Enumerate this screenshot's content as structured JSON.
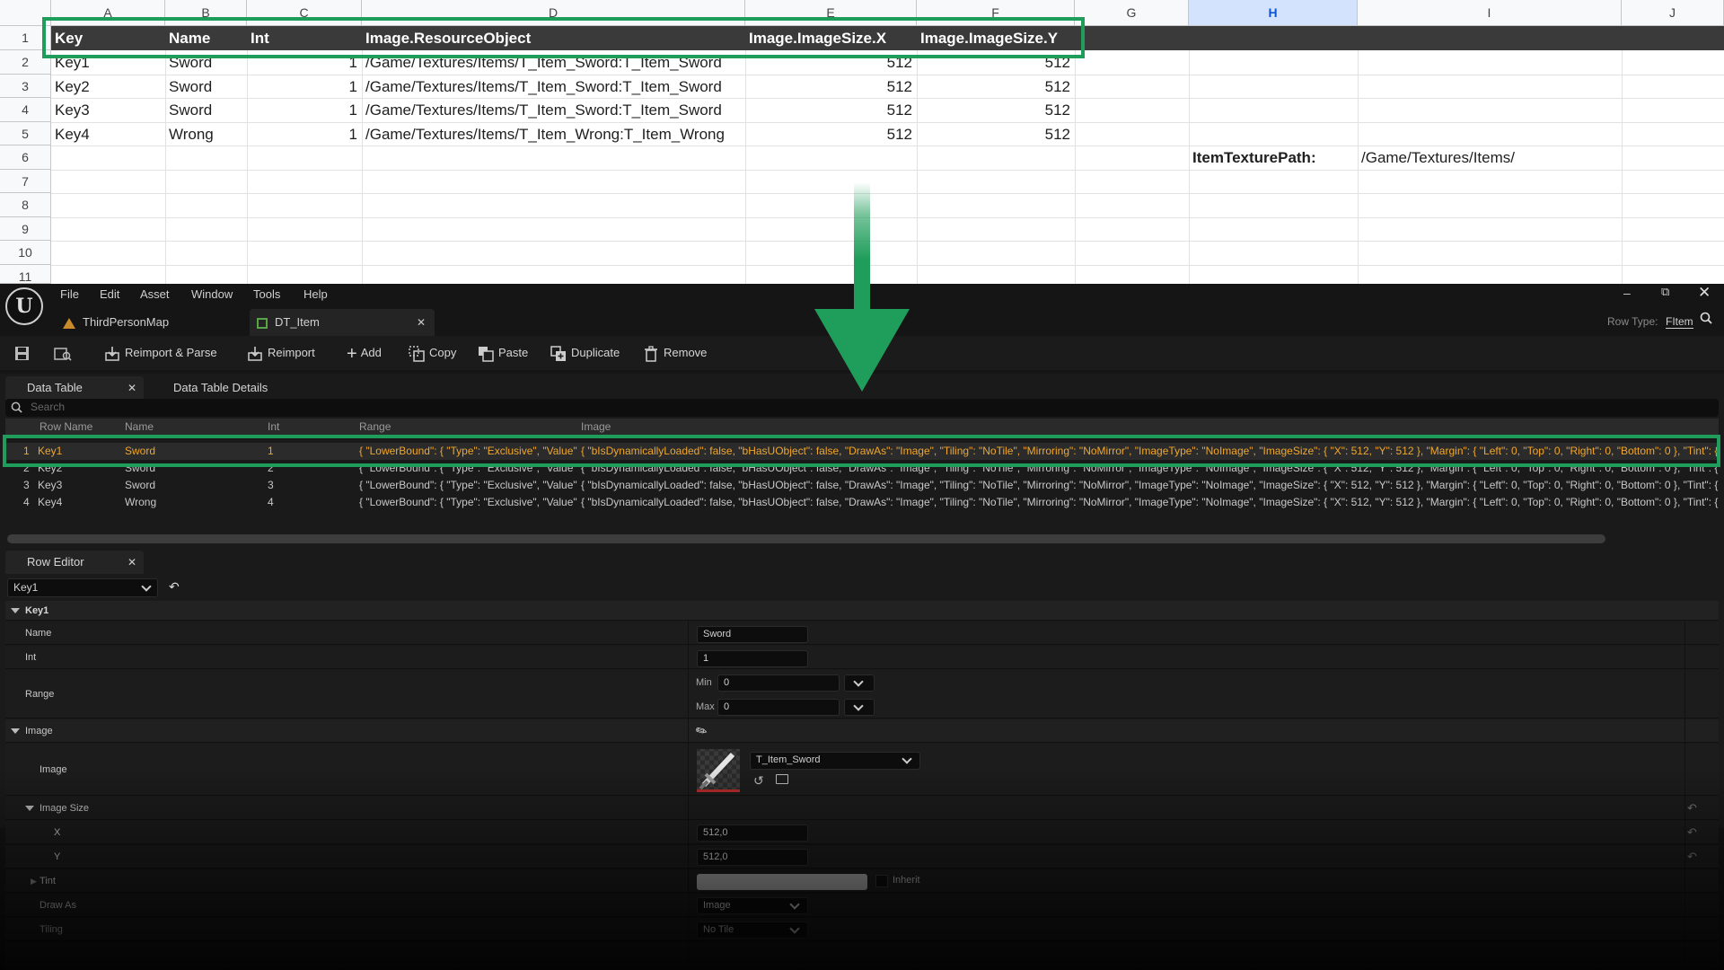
{
  "sheet": {
    "columns": [
      "A",
      "B",
      "C",
      "D",
      "E",
      "F",
      "G",
      "H",
      "I",
      "J"
    ],
    "rows": [
      "1",
      "2",
      "3",
      "4",
      "5",
      "6",
      "7",
      "8",
      "9",
      "10",
      "11"
    ],
    "header": [
      "Key",
      "Name",
      "Int",
      "Image.ResourceObject",
      "Image.ImageSize.X",
      "Image.ImageSize.Y"
    ],
    "data": [
      [
        "Key1",
        "Sword",
        "1",
        "/Game/Textures/Items/T_Item_Sword:T_Item_Sword",
        "512",
        "512"
      ],
      [
        "Key2",
        "Sword",
        "1",
        "/Game/Textures/Items/T_Item_Sword:T_Item_Sword",
        "512",
        "512"
      ],
      [
        "Key3",
        "Sword",
        "1",
        "/Game/Textures/Items/T_Item_Sword:T_Item_Sword",
        "512",
        "512"
      ],
      [
        "Key4",
        "Wrong",
        "1",
        "/Game/Textures/Items/T_Item_Wrong:T_Item_Wrong",
        "512",
        "512"
      ]
    ],
    "path_label": "ItemTexturePath:",
    "path_value": "/Game/Textures/Items/"
  },
  "colors": {
    "highlight": "#1f9d5a",
    "selected_text": "#f0a62c"
  },
  "editor": {
    "menu": [
      "File",
      "Edit",
      "Asset",
      "Window",
      "Tools",
      "Help"
    ],
    "tabs": [
      "ThirdPersonMap",
      "DT_Item"
    ],
    "row_type_label": "Row Type:",
    "row_type_value": "FItem",
    "toolbar": [
      "Reimport & Parse",
      "Reimport",
      "Add",
      "Copy",
      "Paste",
      "Duplicate",
      "Remove"
    ],
    "panel_tabs": [
      "Data Table",
      "Data Table Details"
    ],
    "search_placeholder": "Search",
    "columns": [
      "Row Name",
      "Name",
      "Int",
      "Range",
      "Image"
    ],
    "rows": [
      {
        "idx": "1",
        "key": "Key1",
        "name": "Sword",
        "int": "1"
      },
      {
        "idx": "2",
        "key": "Key2",
        "name": "Sword",
        "int": "2"
      },
      {
        "idx": "3",
        "key": "Key3",
        "name": "Sword",
        "int": "3"
      },
      {
        "idx": "4",
        "key": "Key4",
        "name": "Wrong",
        "int": "4"
      }
    ],
    "range_text": "{ \"LowerBound\": { \"Type\": \"Exclusive\", \"Value\"",
    "image_text": "{ \"bIsDynamicallyLoaded\": false, \"bHasUObject\": false, \"DrawAs\": \"Image\", \"Tiling\": \"NoTile\", \"Mirroring\": \"NoMirror\", \"ImageType\": \"NoImage\", \"ImageSize\": { \"X\": 512, \"Y\": 512 }, \"Margin\": { \"Left\": 0, \"Top\": 0, \"Right\": 0, \"Bottom\": 0 }, \"Tint\": { \"R\"",
    "row_editor": {
      "tab": "Row Editor",
      "selected_row": "Key1",
      "section": "Key1",
      "name_label": "Name",
      "name_value": "Sword",
      "int_label": "Int",
      "int_value": "1",
      "range_label": "Range",
      "min_label": "Min",
      "min_value": "0",
      "max_label": "Max",
      "max_value": "0",
      "image_section": "Image",
      "image_label": "Image",
      "image_asset": "T_Item_Sword",
      "size_label": "Image Size",
      "x_label": "X",
      "x_value": "512,0",
      "y_label": "Y",
      "y_value": "512,0",
      "tint_label": "Tint",
      "inherit_label": "Inherit",
      "drawas_label": "Draw As",
      "drawas_value": "Image",
      "tiling_label": "Tiling",
      "tiling_value": "No Tile"
    }
  }
}
